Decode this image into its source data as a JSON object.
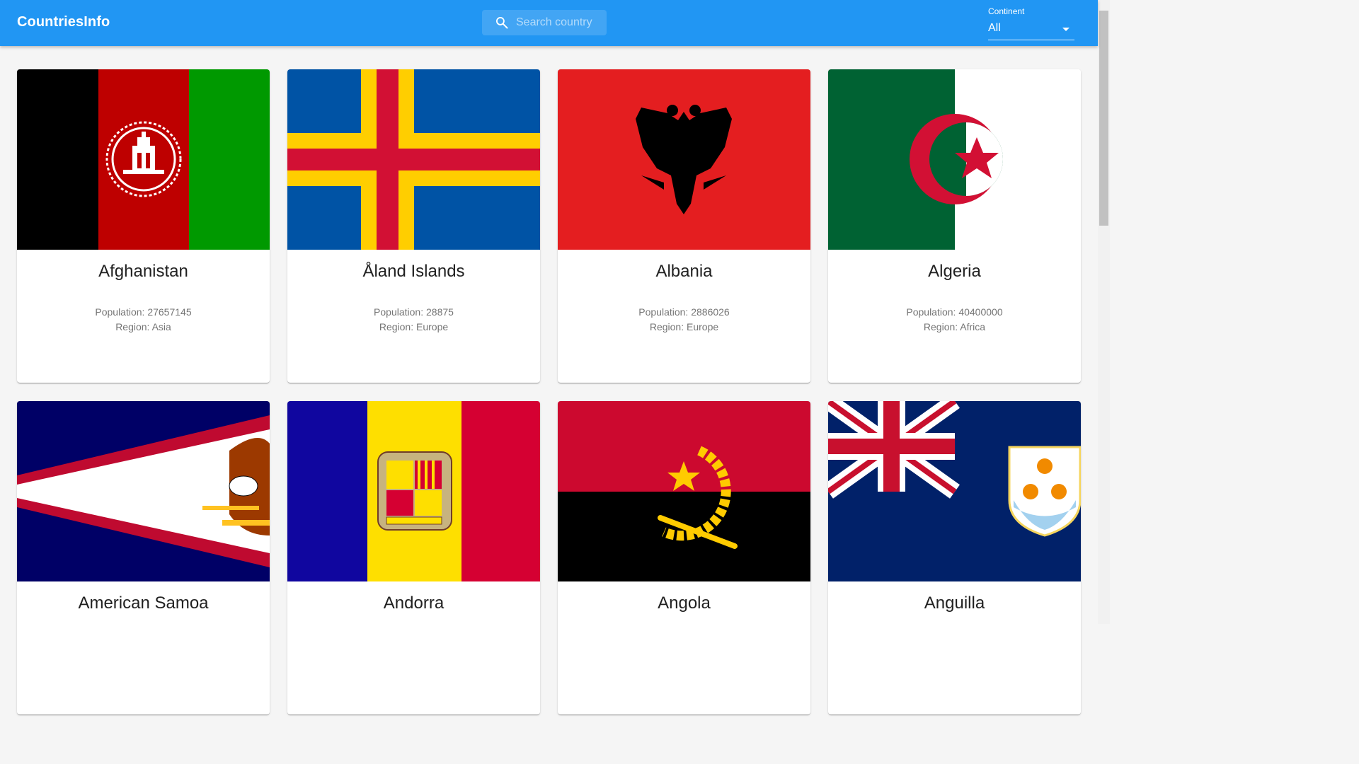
{
  "app": {
    "title": "CountriesInfo"
  },
  "search": {
    "placeholder": "Search country",
    "value": ""
  },
  "continent_filter": {
    "label": "Continent",
    "value": "All"
  },
  "labels": {
    "population": "Population: ",
    "region": "Region: "
  },
  "countries": [
    {
      "name": "Afghanistan",
      "population": "27657145",
      "region": "Asia"
    },
    {
      "name": "Åland Islands",
      "population": "28875",
      "region": "Europe"
    },
    {
      "name": "Albania",
      "population": "2886026",
      "region": "Europe"
    },
    {
      "name": "Algeria",
      "population": "40400000",
      "region": "Africa"
    },
    {
      "name": "American Samoa",
      "population": "",
      "region": ""
    },
    {
      "name": "Andorra",
      "population": "",
      "region": ""
    },
    {
      "name": "Angola",
      "population": "",
      "region": ""
    },
    {
      "name": "Anguilla",
      "population": "",
      "region": ""
    }
  ],
  "icons": {
    "search": "search-icon",
    "dropdown": "chevron-down-icon"
  },
  "colors": {
    "appbar": "#2196f3",
    "background": "#f5f5f5"
  }
}
